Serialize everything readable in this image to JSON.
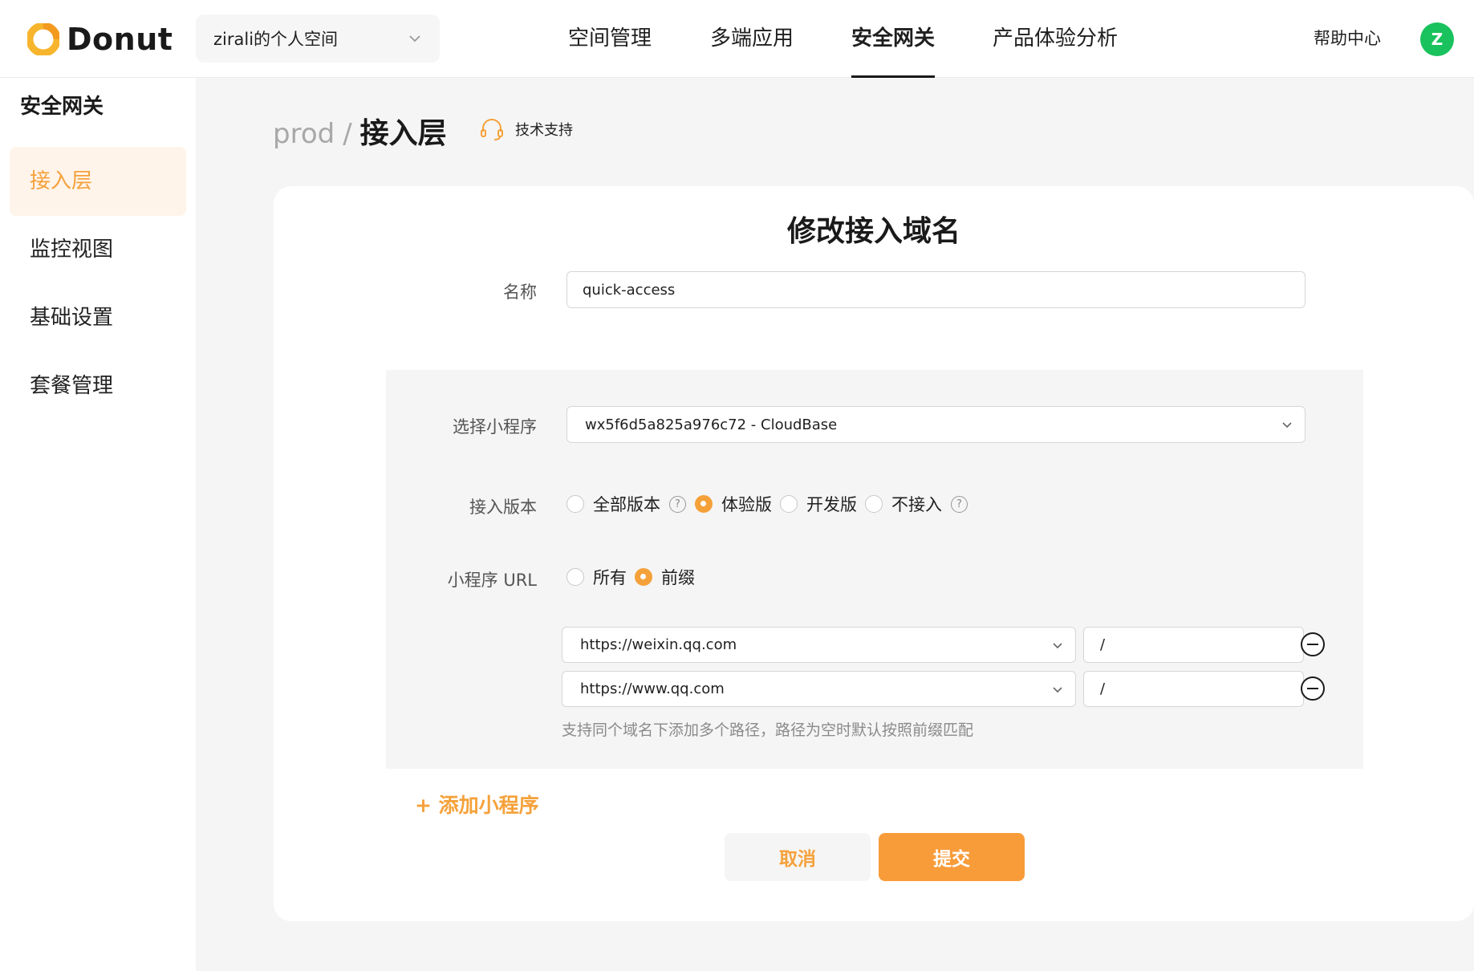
{
  "header": {
    "logo_text": "Donut",
    "workspace": "zirali的个人空间",
    "nav": [
      "空间管理",
      "多端应用",
      "安全网关",
      "产品体验分析"
    ],
    "help": "帮助中心",
    "avatar_letter": "Z"
  },
  "sidebar": {
    "title": "安全网关",
    "items": [
      "接入层",
      "监控视图",
      "基础设置",
      "套餐管理"
    ]
  },
  "breadcrumb": {
    "parent": "prod",
    "separator": "/",
    "current": "接入层",
    "support": "技术支持"
  },
  "form": {
    "title": "修改接入域名",
    "name_label": "名称",
    "name_value": "quick-access",
    "mini_label": "选择小程序",
    "mini_value": "wx5f6d5a825a976c72 - CloudBase",
    "version_label": "接入版本",
    "versions": [
      "全部版本",
      "体验版",
      "开发版",
      "不接入"
    ],
    "url_label": "小程序 URL",
    "url_options": [
      "所有",
      "前缀"
    ],
    "domains": [
      {
        "domain": "https://weixin.qq.com",
        "path": "/"
      },
      {
        "domain": "https://www.qq.com",
        "path": "/"
      }
    ],
    "hint": "支持同个域名下添加多个路径，路径为空时默认按照前缀匹配",
    "add_mini": "添加小程序",
    "cancel": "取消",
    "submit": "提交"
  },
  "colors": {
    "accent": "#f5a13a",
    "avatar": "#19c25d"
  }
}
